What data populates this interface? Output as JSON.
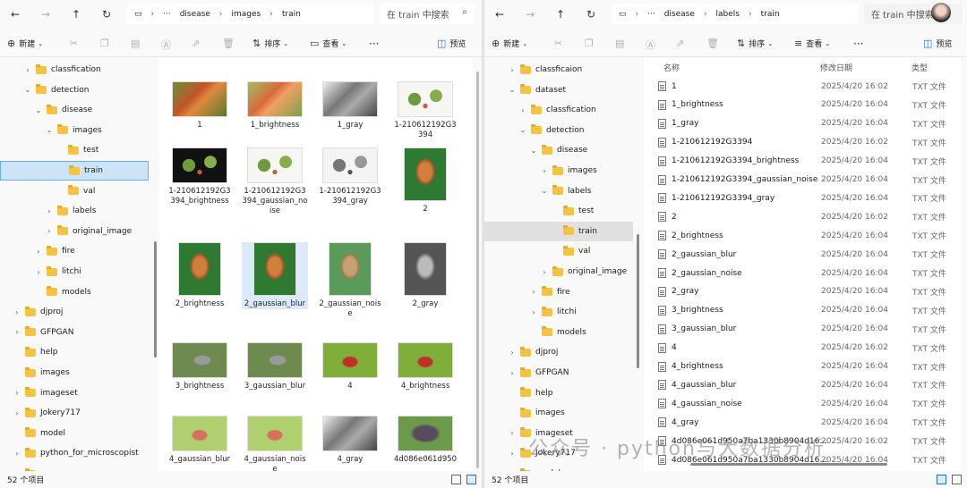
{
  "left": {
    "breadcrumb": [
      "disease",
      "images",
      "train"
    ],
    "search_placeholder": "在 train 中搜索",
    "toolbar": {
      "new": "新建",
      "sort": "排序",
      "view": "查看",
      "preview": "预览"
    },
    "tree": [
      {
        "label": "classfication",
        "depth": 3,
        "chev": "›"
      },
      {
        "label": "detection",
        "depth": 3,
        "chev": "⌄"
      },
      {
        "label": "disease",
        "depth": 4,
        "chev": "⌄"
      },
      {
        "label": "images",
        "depth": 5,
        "chev": "⌄"
      },
      {
        "label": "test",
        "depth": 6,
        "chev": ""
      },
      {
        "label": "train",
        "depth": 6,
        "chev": "",
        "selected": true
      },
      {
        "label": "val",
        "depth": 6,
        "chev": ""
      },
      {
        "label": "labels",
        "depth": 5,
        "chev": "›"
      },
      {
        "label": "original_image",
        "depth": 5,
        "chev": "›"
      },
      {
        "label": "fire",
        "depth": 4,
        "chev": "›"
      },
      {
        "label": "litchi",
        "depth": 4,
        "chev": "›"
      },
      {
        "label": "models",
        "depth": 4,
        "chev": ""
      },
      {
        "label": "djproj",
        "depth": 2,
        "chev": "›"
      },
      {
        "label": "GFPGAN",
        "depth": 2,
        "chev": "›"
      },
      {
        "label": "help",
        "depth": 2,
        "chev": ""
      },
      {
        "label": "images",
        "depth": 2,
        "chev": ""
      },
      {
        "label": "imageset",
        "depth": 2,
        "chev": "›"
      },
      {
        "label": "Jokery717",
        "depth": 2,
        "chev": "›"
      },
      {
        "label": "model",
        "depth": 2,
        "chev": ""
      },
      {
        "label": "python_for_microscopist",
        "depth": 2,
        "chev": "›"
      },
      {
        "label": "resource",
        "depth": 2,
        "chev": "›"
      }
    ],
    "tiles": [
      {
        "name": "1",
        "kind": "fruit"
      },
      {
        "name": "1_brightness",
        "kind": "fruit-bright"
      },
      {
        "name": "1_gray",
        "kind": "gray"
      },
      {
        "name": "1-210612192G3394",
        "kind": "leaves-white"
      },
      {
        "name": "1-210612192G3394_brightness",
        "kind": "leaves-dark"
      },
      {
        "name": "1-210612192G3394_gaussian_noise",
        "kind": "leaves-white"
      },
      {
        "name": "1-210612192G3394_gray",
        "kind": "leaves-gray"
      },
      {
        "name": "2",
        "kind": "tall-fruit"
      },
      {
        "name": "2_brightness",
        "kind": "tall-fruit"
      },
      {
        "name": "2_gaussian_blur",
        "kind": "tall-fruit",
        "highlight": true
      },
      {
        "name": "2_gaussian_noise",
        "kind": "tall-fruit-noise"
      },
      {
        "name": "2_gray",
        "kind": "tall-gray"
      },
      {
        "name": "3_brightness",
        "kind": "bug-leaf"
      },
      {
        "name": "3_gaussian_blur",
        "kind": "bug-leaf"
      },
      {
        "name": "4",
        "kind": "red-bug"
      },
      {
        "name": "4_brightness",
        "kind": "red-bug"
      },
      {
        "name": "4_gaussian_blur",
        "kind": "red-bug-light"
      },
      {
        "name": "4_gaussian_noise",
        "kind": "red-bug-light"
      },
      {
        "name": "4_gray",
        "kind": "gray"
      },
      {
        "name": "4d086e061d950",
        "kind": "purple"
      }
    ],
    "status": "52 个项目"
  },
  "right": {
    "breadcrumb": [
      "disease",
      "labels",
      "train"
    ],
    "search_placeholder": "在 train 中搜索",
    "toolbar": {
      "new": "新建",
      "sort": "排序",
      "view": "查看",
      "preview": "预览"
    },
    "tree": [
      {
        "label": "classficaion",
        "depth": 3,
        "chev": "›"
      },
      {
        "label": "dataset",
        "depth": 3,
        "chev": "⌄"
      },
      {
        "label": "classfication",
        "depth": 4,
        "chev": "›"
      },
      {
        "label": "detection",
        "depth": 4,
        "chev": "⌄"
      },
      {
        "label": "disease",
        "depth": 5,
        "chev": "⌄"
      },
      {
        "label": "images",
        "depth": 6,
        "chev": "›"
      },
      {
        "label": "labels",
        "depth": 6,
        "chev": "⌄"
      },
      {
        "label": "test",
        "depth": 7,
        "chev": ""
      },
      {
        "label": "train",
        "depth": 7,
        "chev": "",
        "selected": true
      },
      {
        "label": "val",
        "depth": 7,
        "chev": ""
      },
      {
        "label": "original_image",
        "depth": 6,
        "chev": "›"
      },
      {
        "label": "fire",
        "depth": 5,
        "chev": "›"
      },
      {
        "label": "litchi",
        "depth": 5,
        "chev": "›"
      },
      {
        "label": "models",
        "depth": 5,
        "chev": ""
      },
      {
        "label": "djproj",
        "depth": 3,
        "chev": "›"
      },
      {
        "label": "GFPGAN",
        "depth": 3,
        "chev": "›"
      },
      {
        "label": "help",
        "depth": 3,
        "chev": ""
      },
      {
        "label": "images",
        "depth": 3,
        "chev": ""
      },
      {
        "label": "imageset",
        "depth": 3,
        "chev": "›"
      },
      {
        "label": "Jokery717",
        "depth": 3,
        "chev": "›"
      },
      {
        "label": "model",
        "depth": 3,
        "chev": ""
      }
    ],
    "columns": {
      "name": "名称",
      "date": "修改日期",
      "type": "类型"
    },
    "files": [
      {
        "name": "1",
        "date": "2025/4/20 16:02",
        "type": "TXT 文件"
      },
      {
        "name": "1_brightness",
        "date": "2025/4/20 16:04",
        "type": "TXT 文件"
      },
      {
        "name": "1_gray",
        "date": "2025/4/20 16:04",
        "type": "TXT 文件"
      },
      {
        "name": "1-210612192G3394",
        "date": "2025/4/20 16:02",
        "type": "TXT 文件"
      },
      {
        "name": "1-210612192G3394_brightness",
        "date": "2025/4/20 16:04",
        "type": "TXT 文件"
      },
      {
        "name": "1-210612192G3394_gaussian_noise",
        "date": "2025/4/20 16:04",
        "type": "TXT 文件"
      },
      {
        "name": "1-210612192G3394_gray",
        "date": "2025/4/20 16:04",
        "type": "TXT 文件"
      },
      {
        "name": "2",
        "date": "2025/4/20 16:02",
        "type": "TXT 文件"
      },
      {
        "name": "2_brightness",
        "date": "2025/4/20 16:04",
        "type": "TXT 文件"
      },
      {
        "name": "2_gaussian_blur",
        "date": "2025/4/20 16:04",
        "type": "TXT 文件"
      },
      {
        "name": "2_gaussian_noise",
        "date": "2025/4/20 16:04",
        "type": "TXT 文件"
      },
      {
        "name": "2_gray",
        "date": "2025/4/20 16:04",
        "type": "TXT 文件"
      },
      {
        "name": "3_brightness",
        "date": "2025/4/20 16:04",
        "type": "TXT 文件"
      },
      {
        "name": "3_gaussian_blur",
        "date": "2025/4/20 16:04",
        "type": "TXT 文件"
      },
      {
        "name": "4",
        "date": "2025/4/20 16:02",
        "type": "TXT 文件"
      },
      {
        "name": "4_brightness",
        "date": "2025/4/20 16:04",
        "type": "TXT 文件"
      },
      {
        "name": "4_gaussian_blur",
        "date": "2025/4/20 16:04",
        "type": "TXT 文件"
      },
      {
        "name": "4_gaussian_noise",
        "date": "2025/4/20 16:04",
        "type": "TXT 文件"
      },
      {
        "name": "4_gray",
        "date": "2025/4/20 16:04",
        "type": "TXT 文件"
      },
      {
        "name": "4d086e061d950a7ba1330b8904d16...",
        "date": "2025/4/20 16:02",
        "type": "TXT 文件"
      },
      {
        "name": "4d086e061d950a7ba1330b8904d16...",
        "date": "2025/4/20 16:04",
        "type": "TXT 文件"
      }
    ],
    "status": "52 个项目"
  },
  "watermark": "公众号 · python与大数据分析",
  "colors": {
    "accent": "#1a73d2",
    "folder": "#f5c242",
    "selection": "#cce4f7"
  }
}
